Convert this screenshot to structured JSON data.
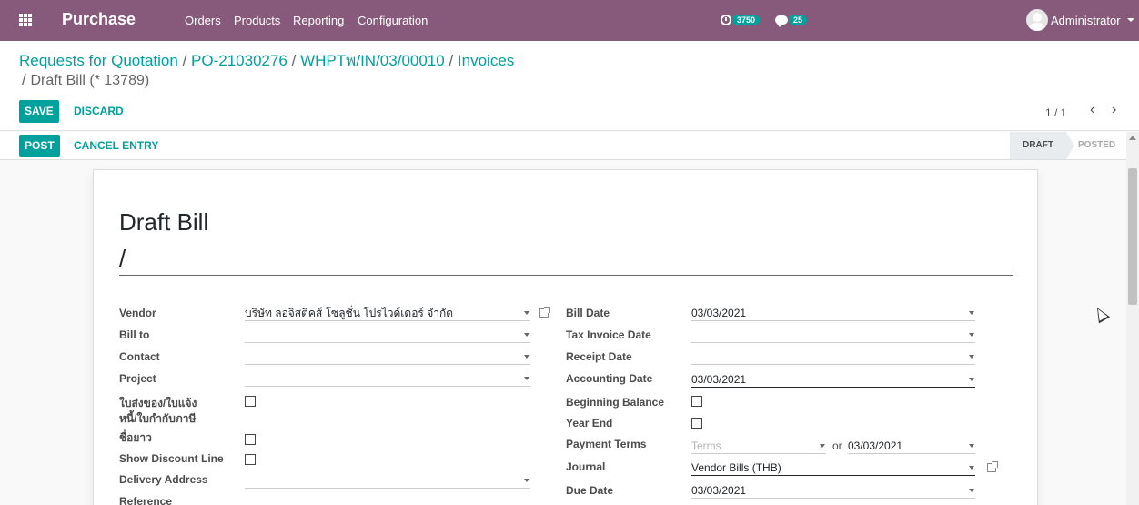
{
  "navbar": {
    "app_name": "Purchase",
    "menu": [
      "Orders",
      "Products",
      "Reporting",
      "Configuration"
    ],
    "activity_count": "3750",
    "message_count": "25",
    "user_name": "Administrator"
  },
  "breadcrumb": {
    "items": [
      "Requests for Quotation",
      "PO-21030276",
      "WHPTพ/IN/03/00010",
      "Invoices"
    ],
    "separator": "/",
    "current": "Draft Bill (* 13789)"
  },
  "buttons": {
    "save": "SAVE",
    "discard": "DISCARD",
    "post": "POST",
    "cancel_entry": "CANCEL ENTRY"
  },
  "pager": {
    "value": "1 / 1"
  },
  "status": {
    "steps": [
      "DRAFT",
      "POSTED"
    ],
    "current": "DRAFT"
  },
  "form": {
    "doc_type": "Draft Bill",
    "doc_number": "/",
    "left_labels": {
      "vendor": "Vendor",
      "bill_to": "Bill to",
      "contact": "Contact",
      "project": "Project",
      "delivery_tax_invoice": "ใบส่งของ/ใบแจ้งหนี้/ใบกำกับภาษี",
      "long_name": "ชื่อยาว",
      "show_discount_line": "Show Discount Line",
      "delivery_address": "Delivery Address",
      "reference": "Reference"
    },
    "left_values": {
      "vendor": "บริษัท ลอจิสติคส์ โซลูชั่น โปรไวด์เดอร์ จำกัด",
      "bill_to": "",
      "contact": "",
      "project": "",
      "delivery_address": ""
    },
    "right_labels": {
      "bill_date": "Bill Date",
      "tax_invoice_date": "Tax Invoice Date",
      "receipt_date": "Receipt Date",
      "accounting_date": "Accounting Date",
      "beginning_balance": "Beginning Balance",
      "year_end": "Year End",
      "payment_terms": "Payment Terms",
      "journal": "Journal",
      "due_date": "Due Date"
    },
    "right_values": {
      "bill_date": "03/03/2021",
      "tax_invoice_date": "",
      "receipt_date": "",
      "accounting_date": "03/03/2021",
      "payment_terms_placeholder": "Terms",
      "or_label": "or",
      "payment_terms_date": "03/03/2021",
      "journal": "Vendor Bills (THB)",
      "due_date": "03/03/2021"
    }
  }
}
